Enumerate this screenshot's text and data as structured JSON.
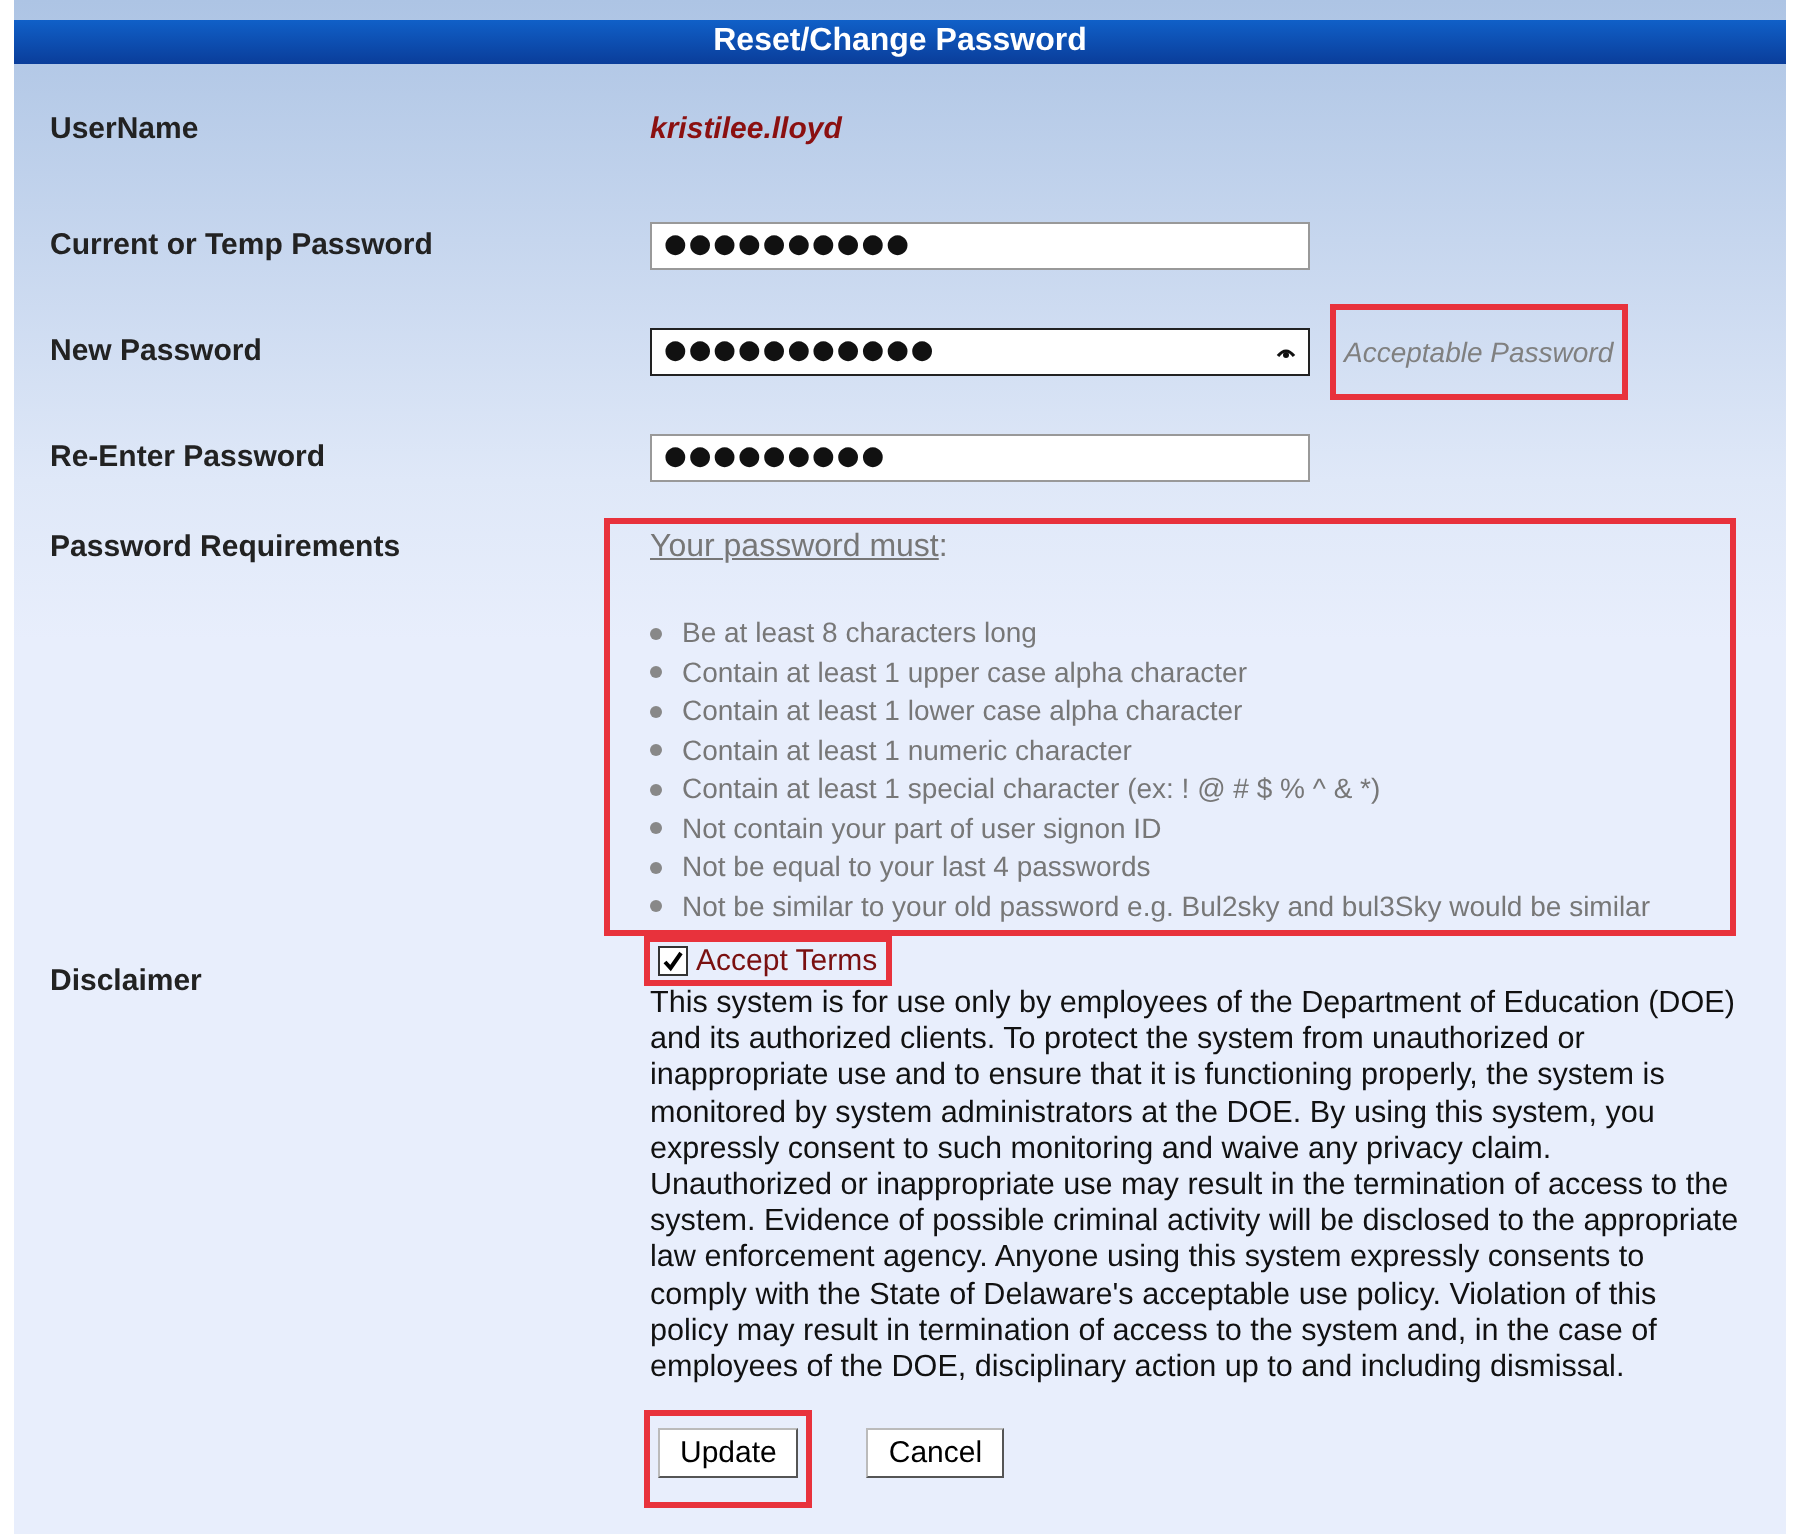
{
  "title": "Reset/Change Password",
  "username": {
    "label": "UserName",
    "value": "kristilee.lloyd"
  },
  "fields": [
    {
      "label": "Current or Temp Password",
      "value": "●●●●●●●●●●",
      "focused": false
    },
    {
      "label": "New Password",
      "value": "●●●●●●●●●●●",
      "focused": true,
      "status": {
        "text": "Acceptable Password",
        "highlighted": true
      }
    },
    {
      "label": "Re-Enter Password",
      "value": "●●●●●●●●●",
      "focused": false
    }
  ],
  "requirements": {
    "label": "Password Requirements",
    "heading": "Your password must",
    "heading_suffix": ":",
    "highlighted": true,
    "items": [
      "Be at least 8 characters long",
      "Contain at least 1 upper case alpha character",
      "Contain at least 1 lower case alpha character",
      "Contain at least 1 numeric character",
      "Contain at least 1 special character (ex: ! @ # $ % ^ & *)",
      "Not contain your part of user signon ID",
      "Not be equal to your last 4 passwords",
      "Not be similar to your old password e.g. Bul2sky and bul3Sky would be similar"
    ]
  },
  "disclaimer": {
    "label": "Disclaimer",
    "checkbox_label": "Accept Terms",
    "checked": true,
    "highlighted": true,
    "text": "This system is for use only by employees of the Department of Education (DOE) and its authorized clients. To protect the system from unauthorized or inappropriate use and to ensure that it is functioning properly, the system is monitored by system administrators at the DOE. By using this system, you expressly consent to such monitoring and waive any privacy claim. Unauthorized or inappropriate use may result in the termination of access to the system. Evidence of possible criminal activity will be disclosed to the appropriate law enforcement agency. Anyone using this system expressly consents to comply with the State of Delaware's acceptable use policy. Violation of this policy may result in termination of access to the system and, in the case of employees of the DOE, disciplinary action up to and including dismissal."
  },
  "buttons": [
    {
      "label": "Update",
      "highlighted": true
    },
    {
      "label": "Cancel"
    }
  ]
}
